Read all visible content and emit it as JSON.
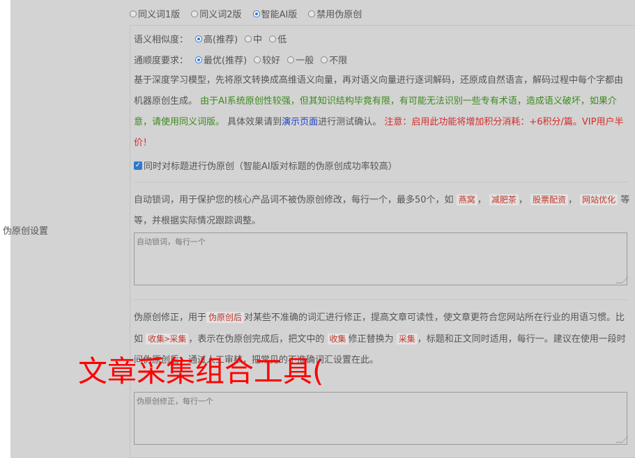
{
  "section_label": "伪原创设置",
  "top_options": [
    {
      "label": "同义词1版",
      "selected": false
    },
    {
      "label": "同义词2版",
      "selected": false
    },
    {
      "label": "智能AI版",
      "selected": true
    },
    {
      "label": "禁用伪原创",
      "selected": false
    }
  ],
  "similarity": {
    "label": "语义相似度：",
    "options": [
      {
        "label": "高(推荐)",
        "selected": true
      },
      {
        "label": "中",
        "selected": false
      },
      {
        "label": "低",
        "selected": false
      }
    ]
  },
  "fluency": {
    "label": "通顺度要求：",
    "options": [
      {
        "label": "最优(推荐)",
        "selected": true
      },
      {
        "label": "较好",
        "selected": false
      },
      {
        "label": "一般",
        "selected": false
      },
      {
        "label": "不限",
        "selected": false
      }
    ]
  },
  "desc": {
    "part1": "基于深度学习模型，先将原文转换成高维语义向量，再对语义向量进行逐词解码，还原成自然语言，解码过程中每个字都由机器原创生成。",
    "green": "由于AI系统原创性较强，但其知识结构毕竟有限，有可能无法识别一些专有术语，造成语义破坏，如果介意，请使用同义词版。",
    "part2": "具体效果请到",
    "link": "演示页面",
    "part3": "进行测试确认。",
    "red": "注意：启用此功能将增加积分消耗：+6积分/篇。VIP用户半价！"
  },
  "title_checkbox": {
    "label": "同时对标题进行伪原创（智能AI版对标题的伪原创成功率较高）",
    "checked": true
  },
  "lock_words": {
    "desc1": "自动锁词，用于保护您的核心产品词不被伪原创修改，每行一个，最多50个，如",
    "examples": [
      "燕窝",
      "减肥茶",
      "股票配资",
      "网站优化"
    ],
    "desc2": "等等，并根据实际情况跟踪调整。",
    "placeholder": "自动锁词，每行一个"
  },
  "correction": {
    "d1": "伪原创修正，用于",
    "tag1": "伪原创后",
    "d2": "对某些不准确的词汇进行修正，提高文章可读性，使文章更符合您网站所在行业的用语习惯。比如",
    "tag2": "收集>采集",
    "d3": "，表示在伪原创完成后，把文中的",
    "tag3": "收集",
    "d4": "修正替换为",
    "tag4": "采集",
    "d5": "，标题和正文同时适用，每行一",
    "d6": "。建议在使用一段时间伪原创后，通过人工审核，把常见的不准确词汇设置在此。",
    "placeholder": "伪原创修正，每行一个"
  },
  "watermark": "文章采集组合工具("
}
